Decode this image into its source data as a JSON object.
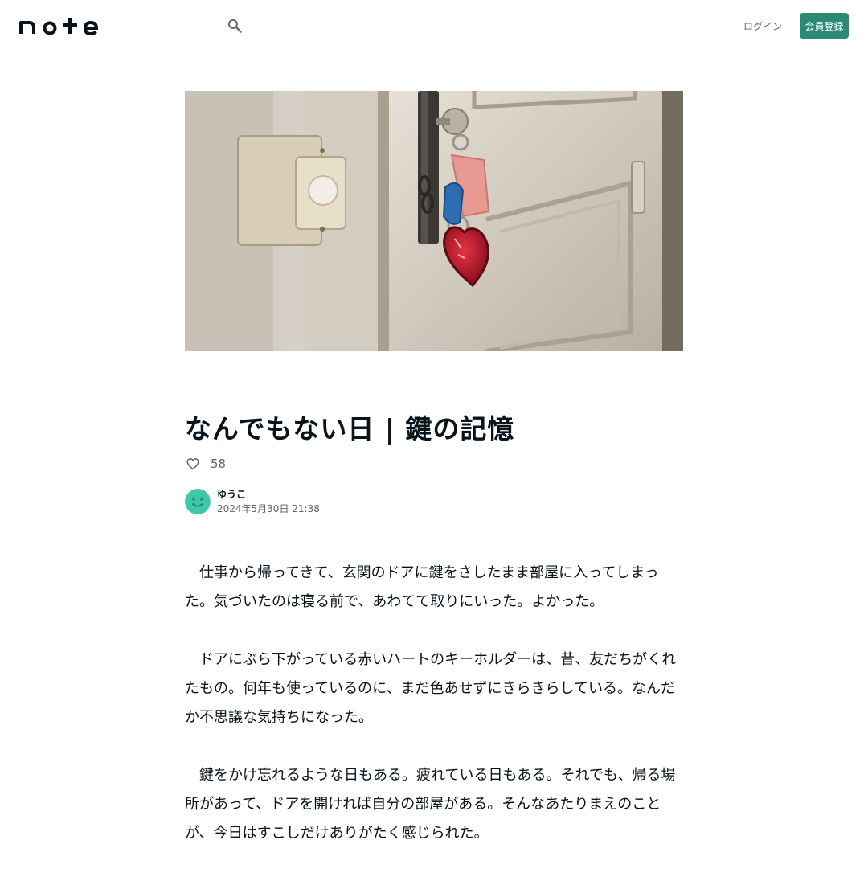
{
  "colors": {
    "brand": "#2a8a74",
    "text_primary": "#08131a",
    "text_secondary": "#5b6268",
    "border": "#dddddd"
  },
  "header": {
    "logo_text": "note",
    "search_icon": "search-icon",
    "login_label": "ログイン",
    "signup_label": "会員登録"
  },
  "article": {
    "title": "なんでもない日 | 鍵の記憶",
    "like_icon": "heart-outline-icon",
    "like_count": "58",
    "author": {
      "name": "ゆうこ",
      "avatar_icon": "smiley-avatar-icon",
      "date": "2024年5月30日 21:38"
    },
    "paragraphs": [
      "仕事から帰ってきて、玄関のドアに鍵をさしたまま部屋に入ってしまった。気づいたのは寝る前で、あわてて取りにいった。よかった。",
      "ドアにぶら下がっている赤いハートのキーホルダーは、昔、友だちがくれたもの。何年も使っているのに、まだ色あせずにきらきらしている。なんだか不思議な気持ちになった。",
      "鍵をかけ忘れるような日もある。疲れている日もある。それでも、帰る場所があって、ドアを開ければ自分の部屋がある。そんなあたりまえのことが、今日はすこしだけありがたく感じられた。"
    ]
  }
}
